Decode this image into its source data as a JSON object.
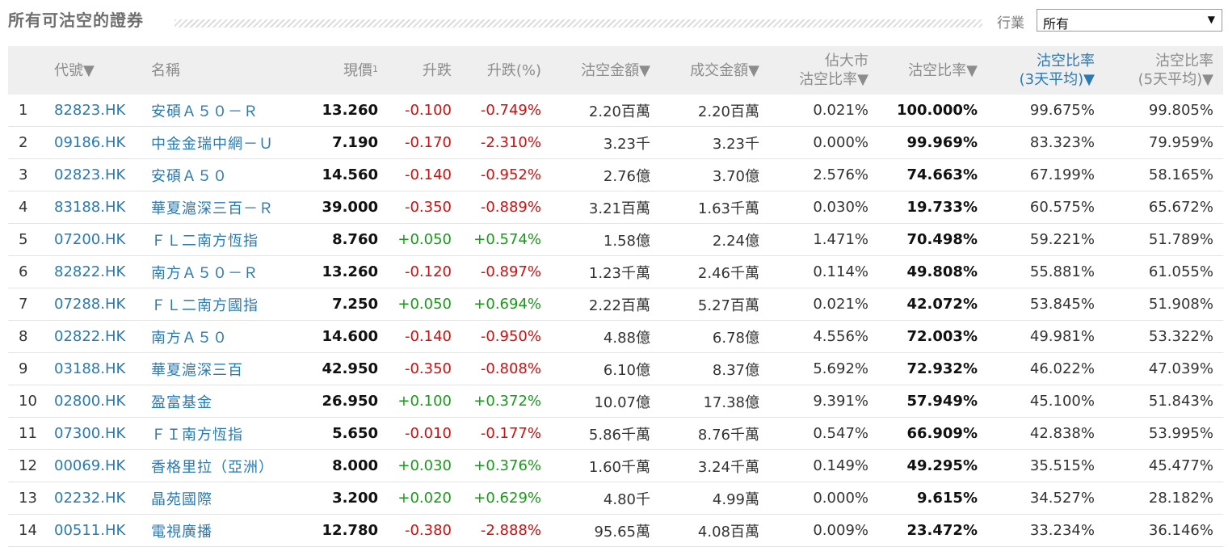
{
  "header": {
    "title": "所有可沽空的證券",
    "industry_label": "行業",
    "industry_selected": "所有",
    "dropdown_arrow": "▼"
  },
  "columns": [
    {
      "key": "rank",
      "label": ""
    },
    {
      "key": "code",
      "label": "代號▼"
    },
    {
      "key": "name",
      "label": "名稱"
    },
    {
      "key": "price",
      "label": "現價",
      "sup": "1"
    },
    {
      "key": "change",
      "label": "升跌"
    },
    {
      "key": "change_pct",
      "label": "升跌(%)"
    },
    {
      "key": "short_amount",
      "label": "沽空金額▼"
    },
    {
      "key": "turnover",
      "label": "成交金額▼"
    },
    {
      "key": "market_share",
      "label": "佔大市",
      "label2": "沽空比率▼"
    },
    {
      "key": "short_ratio",
      "label": "沽空比率▼"
    },
    {
      "key": "ratio_3d",
      "label": "沽空比率",
      "label2": "(3天平均)▼"
    },
    {
      "key": "ratio_5d",
      "label": "沽空比率",
      "label2": "(5天平均)▼"
    }
  ],
  "colors": {
    "up": "#1a9a1a",
    "down": "#cc1111",
    "link": "#2a79b3"
  },
  "rows": [
    {
      "rank": "1",
      "code": "82823.HK",
      "name": "安碩Ａ５０－Ｒ",
      "price": "13.260",
      "change": "-0.100",
      "change_pct": "-0.749%",
      "short_amount": "2.20百萬",
      "turnover": "2.20百萬",
      "market_share": "0.021%",
      "short_ratio": "100.000%",
      "ratio_3d": "99.675%",
      "ratio_5d": "99.805%",
      "dir": "down"
    },
    {
      "rank": "2",
      "code": "09186.HK",
      "name": "中金金瑞中網－Ｕ",
      "price": "7.190",
      "change": "-0.170",
      "change_pct": "-2.310%",
      "short_amount": "3.23千",
      "turnover": "3.23千",
      "market_share": "0.000%",
      "short_ratio": "99.969%",
      "ratio_3d": "83.323%",
      "ratio_5d": "79.959%",
      "dir": "down"
    },
    {
      "rank": "3",
      "code": "02823.HK",
      "name": "安碩Ａ５０",
      "price": "14.560",
      "change": "-0.140",
      "change_pct": "-0.952%",
      "short_amount": "2.76億",
      "turnover": "3.70億",
      "market_share": "2.576%",
      "short_ratio": "74.663%",
      "ratio_3d": "67.199%",
      "ratio_5d": "58.165%",
      "dir": "down"
    },
    {
      "rank": "4",
      "code": "83188.HK",
      "name": "華夏滬深三百－Ｒ",
      "price": "39.000",
      "change": "-0.350",
      "change_pct": "-0.889%",
      "short_amount": "3.21百萬",
      "turnover": "1.63千萬",
      "market_share": "0.030%",
      "short_ratio": "19.733%",
      "ratio_3d": "60.575%",
      "ratio_5d": "65.672%",
      "dir": "down"
    },
    {
      "rank": "5",
      "code": "07200.HK",
      "name": "ＦＬ二南方恆指",
      "price": "8.760",
      "change": "+0.050",
      "change_pct": "+0.574%",
      "short_amount": "1.58億",
      "turnover": "2.24億",
      "market_share": "1.471%",
      "short_ratio": "70.498%",
      "ratio_3d": "59.221%",
      "ratio_5d": "51.789%",
      "dir": "up"
    },
    {
      "rank": "6",
      "code": "82822.HK",
      "name": "南方Ａ５０－Ｒ",
      "price": "13.260",
      "change": "-0.120",
      "change_pct": "-0.897%",
      "short_amount": "1.23千萬",
      "turnover": "2.46千萬",
      "market_share": "0.114%",
      "short_ratio": "49.808%",
      "ratio_3d": "55.881%",
      "ratio_5d": "61.055%",
      "dir": "down"
    },
    {
      "rank": "7",
      "code": "07288.HK",
      "name": "ＦＬ二南方國指",
      "price": "7.250",
      "change": "+0.050",
      "change_pct": "+0.694%",
      "short_amount": "2.22百萬",
      "turnover": "5.27百萬",
      "market_share": "0.021%",
      "short_ratio": "42.072%",
      "ratio_3d": "53.845%",
      "ratio_5d": "51.908%",
      "dir": "up"
    },
    {
      "rank": "8",
      "code": "02822.HK",
      "name": "南方Ａ５０",
      "price": "14.600",
      "change": "-0.140",
      "change_pct": "-0.950%",
      "short_amount": "4.88億",
      "turnover": "6.78億",
      "market_share": "4.556%",
      "short_ratio": "72.003%",
      "ratio_3d": "49.981%",
      "ratio_5d": "53.322%",
      "dir": "down"
    },
    {
      "rank": "9",
      "code": "03188.HK",
      "name": "華夏滬深三百",
      "price": "42.950",
      "change": "-0.350",
      "change_pct": "-0.808%",
      "short_amount": "6.10億",
      "turnover": "8.37億",
      "market_share": "5.692%",
      "short_ratio": "72.932%",
      "ratio_3d": "46.022%",
      "ratio_5d": "47.039%",
      "dir": "down"
    },
    {
      "rank": "10",
      "code": "02800.HK",
      "name": "盈富基金",
      "price": "26.950",
      "change": "+0.100",
      "change_pct": "+0.372%",
      "short_amount": "10.07億",
      "turnover": "17.38億",
      "market_share": "9.391%",
      "short_ratio": "57.949%",
      "ratio_3d": "45.100%",
      "ratio_5d": "51.843%",
      "dir": "up"
    },
    {
      "rank": "11",
      "code": "07300.HK",
      "name": "ＦＩ南方恆指",
      "price": "5.650",
      "change": "-0.010",
      "change_pct": "-0.177%",
      "short_amount": "5.86千萬",
      "turnover": "8.76千萬",
      "market_share": "0.547%",
      "short_ratio": "66.909%",
      "ratio_3d": "42.838%",
      "ratio_5d": "53.995%",
      "dir": "down"
    },
    {
      "rank": "12",
      "code": "00069.HK",
      "name": "香格里拉（亞洲）",
      "price": "8.000",
      "change": "+0.030",
      "change_pct": "+0.376%",
      "short_amount": "1.60千萬",
      "turnover": "3.24千萬",
      "market_share": "0.149%",
      "short_ratio": "49.295%",
      "ratio_3d": "35.515%",
      "ratio_5d": "45.477%",
      "dir": "up"
    },
    {
      "rank": "13",
      "code": "02232.HK",
      "name": "晶苑國際",
      "price": "3.200",
      "change": "+0.020",
      "change_pct": "+0.629%",
      "short_amount": "4.80千",
      "turnover": "4.99萬",
      "market_share": "0.000%",
      "short_ratio": "9.615%",
      "ratio_3d": "34.527%",
      "ratio_5d": "28.182%",
      "dir": "up"
    },
    {
      "rank": "14",
      "code": "00511.HK",
      "name": "電視廣播",
      "price": "12.780",
      "change": "-0.380",
      "change_pct": "-2.888%",
      "short_amount": "95.65萬",
      "turnover": "4.08百萬",
      "market_share": "0.009%",
      "short_ratio": "23.472%",
      "ratio_3d": "33.234%",
      "ratio_5d": "36.146%",
      "dir": "down"
    }
  ]
}
